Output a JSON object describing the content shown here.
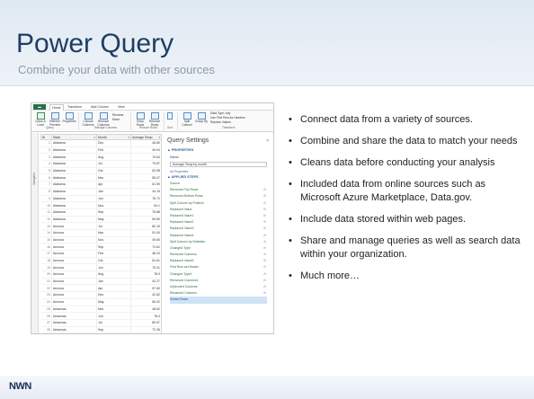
{
  "slide": {
    "title": "Power Query",
    "subtitle": "Combine your data with other sources",
    "logo": "NWN",
    "bullets": [
      "Connect data from a variety of sources.",
      "Combine and share the data to match your needs",
      "Cleans data before conducting your analysis",
      "Included data from online sources such as Microsoft Azure Marketplace, Data.gov.",
      "Include data stored within web pages.",
      "Share and manage queries as well as search data within your organization.",
      "Much more…"
    ]
  },
  "editor": {
    "ribbon_tabs": {
      "file": "",
      "home": "Home",
      "transform": "Transform",
      "add_column": "Add Column",
      "view": "View"
    },
    "ribbon": {
      "close_load": "Close & Load",
      "refresh_preview": "Refresh Preview",
      "properties": "Properties",
      "choose_columns": "Choose Columns",
      "remove_columns": "Remove Columns",
      "rename": "Rename",
      "move": "Move",
      "keep_rows": "Keep Rows",
      "remove_rows": "Remove Rows",
      "split_column": "Split Column",
      "group_by": "Group By",
      "data_type": "Data Type: Any",
      "use_first_row": "Use First Row As Headers",
      "replace_values": "Replace Values",
      "group_query": "Query",
      "group_manage": "Manage Columns",
      "group_reduce": "Reduce Rows",
      "group_sort": "Sort",
      "group_transform": "Transform"
    },
    "navigator_label": "Navigator",
    "columns": [
      "State",
      "Month",
      "Average Temp"
    ],
    "rows": [
      [
        "1",
        "Alabama",
        "Dec",
        "46.80"
      ],
      [
        "2",
        "Alabama",
        "Feb",
        "49.94"
      ],
      [
        "3",
        "Alabama",
        "Aug",
        "79.64"
      ],
      [
        "4",
        "Alabama",
        "Jul",
        "79.87"
      ],
      [
        "5",
        "Alabama",
        "Oct",
        "63.98"
      ],
      [
        "6",
        "Alabama",
        "Mar",
        "55.47"
      ],
      [
        "7",
        "Alabama",
        "Apr",
        "61.90"
      ],
      [
        "8",
        "Alabama",
        "Jan",
        "44.19"
      ],
      [
        "9",
        "Alabama",
        "Jun",
        "76.72"
      ],
      [
        "10",
        "Alabama",
        "Nov",
        "54.1"
      ],
      [
        "11",
        "Alabama",
        "Sep",
        "75.88"
      ],
      [
        "12",
        "Alabama",
        "May",
        "69.89"
      ],
      [
        "13",
        "Arizona",
        "Jul",
        "80.19"
      ],
      [
        "14",
        "Arizona",
        "Mar",
        "51.00"
      ],
      [
        "15",
        "Arizona",
        "Nov",
        "49.60"
      ],
      [
        "16",
        "Arizona",
        "Sep",
        "72.62"
      ],
      [
        "17",
        "Arizona",
        "Feb",
        "48.24"
      ],
      [
        "18",
        "Arizona",
        "Oct",
        "61.61"
      ],
      [
        "19",
        "Arizona",
        "Jun",
        "75.31"
      ],
      [
        "20",
        "Arizona",
        "Aug",
        "78.3"
      ],
      [
        "21",
        "Arizona",
        "Jan",
        "42.27"
      ],
      [
        "22",
        "Arizona",
        "Apr",
        "57.60"
      ],
      [
        "23",
        "Arizona",
        "Dec",
        "42.52"
      ],
      [
        "24",
        "Arizona",
        "May",
        "66.02"
      ],
      [
        "25",
        "Arkansas",
        "Mar",
        "48.62"
      ],
      [
        "26",
        "Arkansas",
        "Jun",
        "78.4"
      ],
      [
        "27",
        "Arkansas",
        "Jul",
        "80.57"
      ],
      [
        "28",
        "Arkansas",
        "Sep",
        "72.26"
      ]
    ],
    "settings": {
      "title": "Query Settings",
      "close": "×",
      "properties_heading": "▲ PROPERTIES",
      "name_label": "Name",
      "name_value": "Average Temp by month",
      "all_properties": "All Properties",
      "applied_steps_heading": "▲ APPLIED STEPS",
      "steps": [
        "Source",
        "Removed Top Rows",
        "Removed Bottom Rows",
        "Split Column by Position",
        "Replaced Value",
        "Replaced Value1",
        "Replaced Value2",
        "Replaced Value3",
        "Replaced Value4",
        "Split Column by Delimiter",
        "Changed Type",
        "Removed Columns",
        "Replaced Value5",
        "First Row as Header",
        "Changed Type1",
        "Removed Columns1",
        "Unpivoted Columns",
        "Renamed Columns",
        "Sorted Rows"
      ],
      "selected_step": "Sorted Rows"
    }
  }
}
